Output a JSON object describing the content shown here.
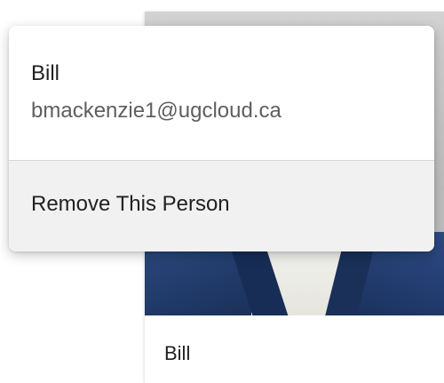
{
  "person_card": {
    "name": "Bill"
  },
  "popup": {
    "name": "Bill",
    "email": "bmackenzie1@ugcloud.ca",
    "action_label": "Remove This Person"
  },
  "colors": {
    "jacket": "#1e3663",
    "action_bg": "#f1f1f1",
    "email_text": "#5f5f5f"
  }
}
